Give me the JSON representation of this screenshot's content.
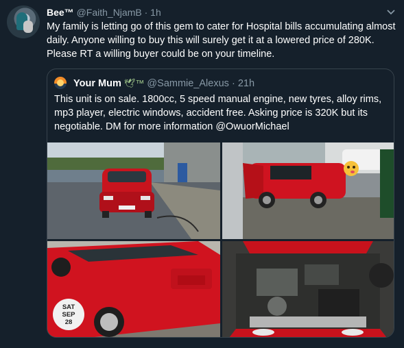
{
  "tweet": {
    "display_name": "Bee™",
    "handle": "@Faith_NjamB",
    "separator": "·",
    "time": "1h",
    "text": "My family is letting go of this gem to cater for Hospital bills accumulating almost daily. Anyone willing to buy this will surely get it at a lowered price of 280K. Please RT a willing buyer could be on your timeline.",
    "caret": "⌄"
  },
  "quoted": {
    "display_name": "Your Mum",
    "badge": "🕊™",
    "handle": "@Sammie_Alexus",
    "separator": "·",
    "time": "21h",
    "text": "This unit is on sale. 1800cc, 5 speed manual engine, new tyres, alloy rims, mp3 player, electric windows, accident free. Asking price is 320K but its negotiable. DM for more information @OwuorMichael",
    "photo_badge": {
      "day": "SAT",
      "month": "SEP",
      "date": "28"
    }
  },
  "colors": {
    "background": "#15202b",
    "secondary_text": "#8899a6",
    "border": "#38444d",
    "car_red": "#d1121c"
  }
}
